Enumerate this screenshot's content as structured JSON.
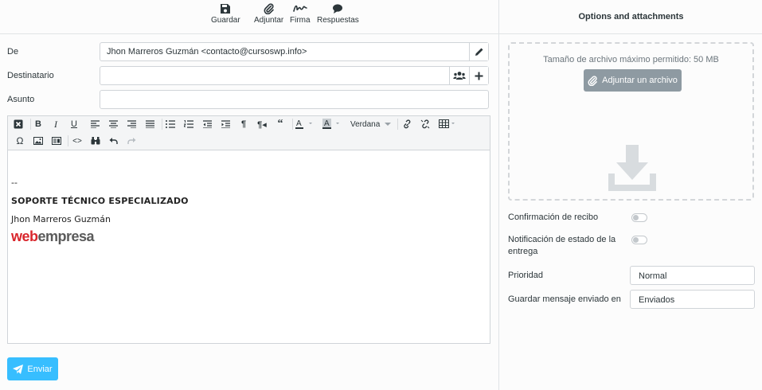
{
  "toolbar": {
    "save": "Guardar",
    "attach": "Adjuntar",
    "signature": "Firma",
    "responses": "Respuestas"
  },
  "form": {
    "from_label": "De",
    "from_value": "Jhon Marreros Guzmán <contacto@cursoswp.info>",
    "to_label": "Destinatario",
    "to_value": "",
    "subject_label": "Asunto",
    "subject_value": ""
  },
  "editor": {
    "font_select": "Verdana",
    "signature_separator": "--",
    "signature_title": "SOPORTE TÉCNICO ESPECIALIZADO",
    "signature_name": "Jhon Marreros Guzmán",
    "logo_text_web": "web",
    "logo_text_empresa": "empresa"
  },
  "send_label": "Enviar",
  "options": {
    "title": "Options and attachments",
    "max_size": "Tamaño de archivo máximo permitido: 50 MB",
    "attach_button": "Adjuntar un archivo",
    "receipt_label": "Confirmación de recibo",
    "receipt_on": false,
    "dsn_label": "Notificación de estado de la entrega",
    "dsn_on": false,
    "priority_label": "Prioridad",
    "priority_value": "Normal",
    "save_sent_label": "Guardar mensaje enviado en",
    "save_sent_value": "Enviados"
  },
  "colors": {
    "accent": "#37beff",
    "attach_button": "#8e9aa2",
    "logo_red": "#d9262c",
    "logo_gray": "#5a5a5a"
  }
}
